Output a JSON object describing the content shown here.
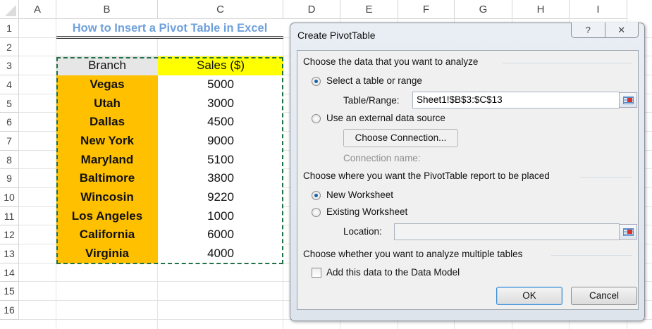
{
  "sheet": {
    "columns": [
      "A",
      "B",
      "C",
      "D",
      "E",
      "F",
      "G",
      "H",
      "I"
    ],
    "rows": [
      "1",
      "2",
      "3",
      "4",
      "5",
      "6",
      "7",
      "8",
      "9",
      "10",
      "11",
      "12",
      "13",
      "14",
      "15",
      "16"
    ],
    "title": "How to Insert a Pivot Table in Excel",
    "headers": {
      "branch": "Branch",
      "sales": "Sales ($)"
    },
    "data": [
      {
        "branch": "Vegas",
        "sales": "5000"
      },
      {
        "branch": "Utah",
        "sales": "3000"
      },
      {
        "branch": "Dallas",
        "sales": "4500"
      },
      {
        "branch": "New York",
        "sales": "9000"
      },
      {
        "branch": "Maryland",
        "sales": "5100"
      },
      {
        "branch": "Baltimore",
        "sales": "3800"
      },
      {
        "branch": "Wincosin",
        "sales": "9220"
      },
      {
        "branch": "Los Angeles",
        "sales": "1000"
      },
      {
        "branch": "California",
        "sales": "6000"
      },
      {
        "branch": "Virginia",
        "sales": "4000"
      }
    ],
    "colors": {
      "title": "#6fa0dc",
      "branch_fill": "#ffc000",
      "sales_header_fill": "#ffff00",
      "header_fill": "#e7e6e6",
      "marquee": "#1e7145"
    }
  },
  "dialog": {
    "title": "Create PivotTable",
    "help": "?",
    "close": "✕",
    "section1": "Choose the data that you want to analyze",
    "opt_select": "Select a table or range",
    "table_range_label": "Table/Range:",
    "table_range_value": "Sheet1!$B$3:$C$13",
    "opt_external": "Use an external data source",
    "choose_connection": "Choose Connection...",
    "connection_name": "Connection name:",
    "section2": "Choose where you want the PivotTable report to be placed",
    "opt_new": "New Worksheet",
    "opt_existing": "Existing Worksheet",
    "location_label": "Location:",
    "location_value": "",
    "section3": "Choose whether you want to analyze multiple tables",
    "data_model": "Add this data to the Data Model",
    "data_model_checked": false,
    "ok": "OK",
    "cancel": "Cancel"
  }
}
